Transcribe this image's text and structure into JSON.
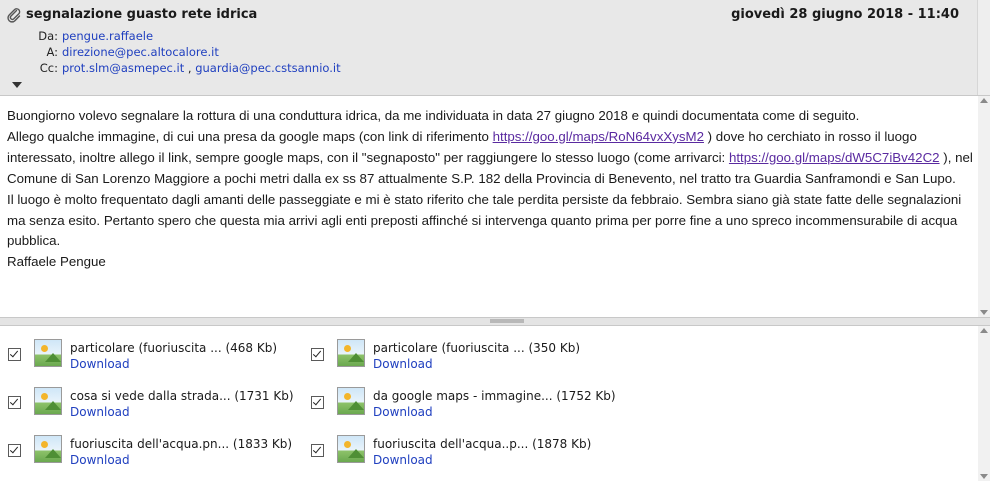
{
  "message": {
    "subject": "segnalazione guasto rete idrica",
    "datetime": "giovedì 28 giugno 2018 - 11:40",
    "from_label": "Da:",
    "from": "pengue.raffaele",
    "to_label": "A:",
    "to": "direzione@pec.altocalore.it",
    "cc_label": "Cc:",
    "cc": [
      "prot.slm@asmepec.it",
      "guardia@pec.cstsannio.it"
    ],
    "cc_separator": " , "
  },
  "body": {
    "p1": "Buongiorno volevo segnalare la rottura di una conduttura idrica, da me individuata in data 27 giugno 2018 e quindi documentata come di seguito.",
    "p2a": "Allego qualche immagine, di cui una presa da google maps (con link di riferimento ",
    "link1": "https://goo.gl/maps/RoN64vxXysM2",
    "p2b": " ) dove ho cerchiato in rosso il luogo interessato, inoltre allego il link, sempre google maps, con il \"segnaposto\" per raggiungere lo stesso luogo (come arrivarci: ",
    "link2": "https://goo.gl/maps/dW5C7iBv42C2",
    "p2c": " ), nel Comune di San Lorenzo Maggiore a pochi metri dalla ex ss 87 attualmente S.P. 182 della Provincia di Benevento, nel tratto tra Guardia Sanframondi e San Lupo.",
    "p3": "Il luogo è molto frequentato dagli amanti delle passeggiate e mi è stato riferito che tale perdita persiste da febbraio. Sembra siano già state fatte delle segnalazioni ma senza esito. Pertanto spero che questa mia arrivi agli enti preposti affinché si intervenga quanto prima per porre fine a uno spreco incommensurabile di acqua pubblica.",
    "signature": "Raffaele Pengue"
  },
  "attachments": [
    {
      "name": "particolare (fuoriuscita ... (468 Kb)",
      "download": "Download",
      "checked": true
    },
    {
      "name": "particolare (fuoriuscita ... (350 Kb)",
      "download": "Download",
      "checked": true
    },
    {
      "name": "cosa si vede dalla strada... (1731 Kb)",
      "download": "Download",
      "checked": true
    },
    {
      "name": "da google maps - immagine... (1752 Kb)",
      "download": "Download",
      "checked": true
    },
    {
      "name": "fuoriuscita dell'acqua.pn... (1833 Kb)",
      "download": "Download",
      "checked": true
    },
    {
      "name": "fuoriuscita dell'acqua..p... (1878 Kb)",
      "download": "Download",
      "checked": true
    }
  ],
  "icons": {
    "attachment": "paperclip-icon",
    "expand": "expand-triangle-icon",
    "thumbnail": "image-file-icon"
  },
  "colors": {
    "link": "#5a2aa0",
    "address": "#1f3fbf",
    "header_bg": "#e8e8e8"
  }
}
